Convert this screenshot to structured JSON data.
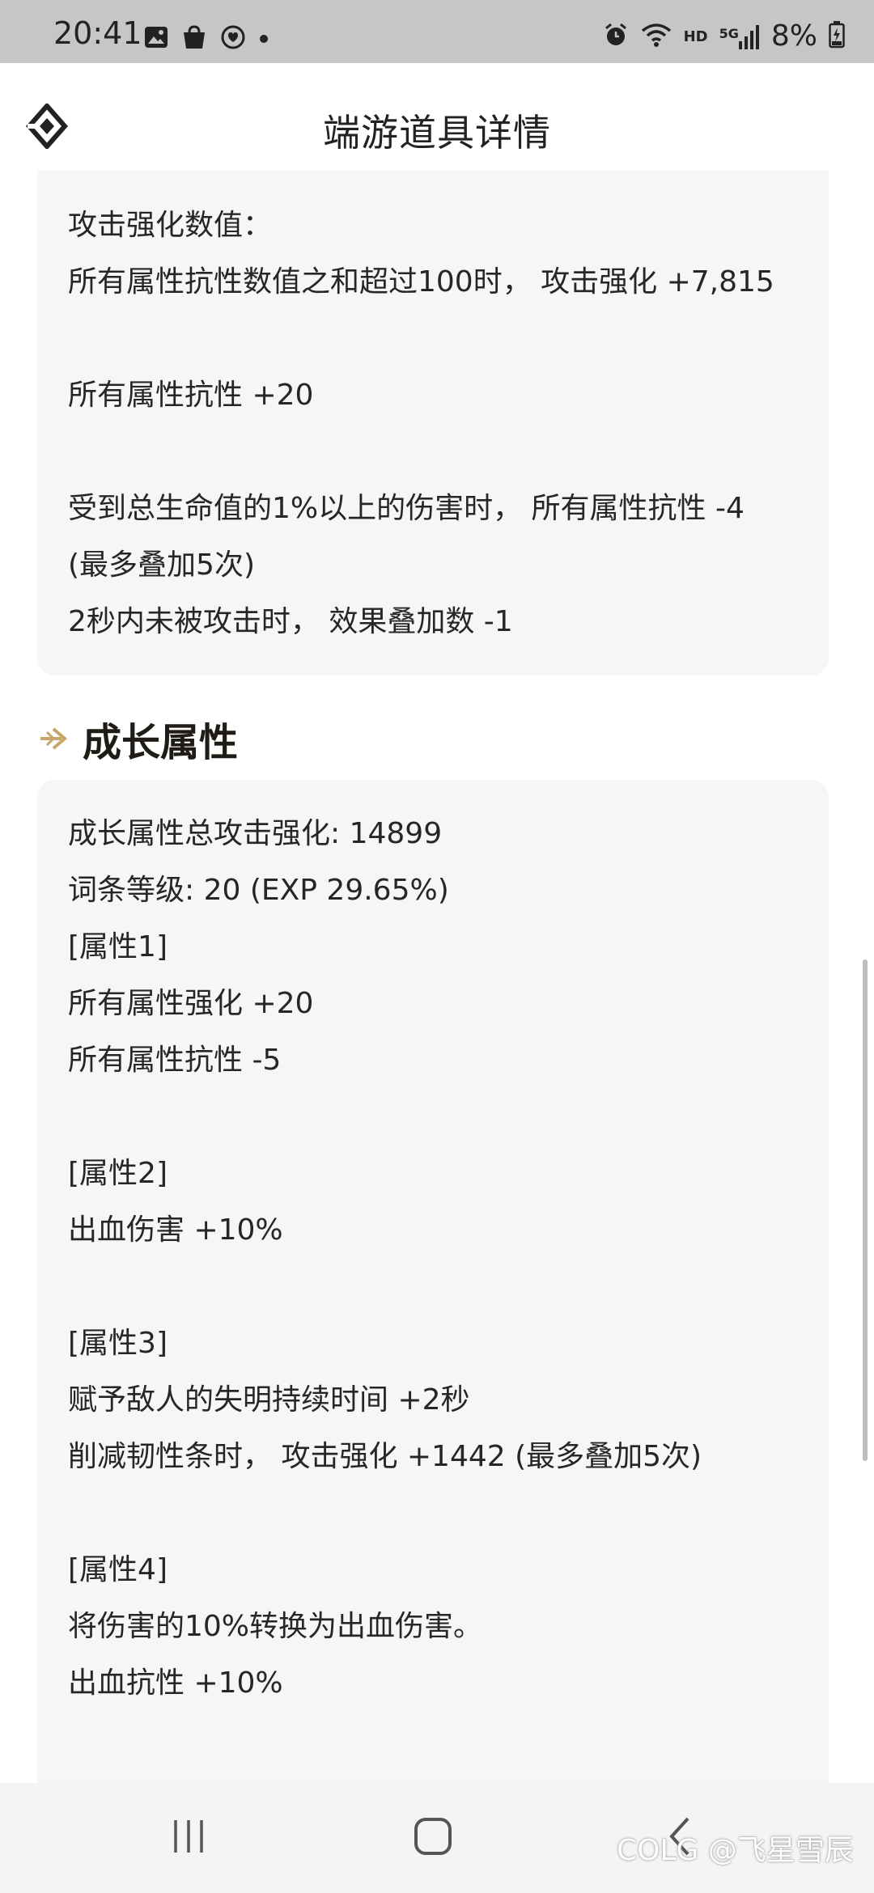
{
  "status_bar": {
    "time": "20:41",
    "left_icons": [
      "gallery-icon",
      "shopping-bag-icon",
      "heart-rate-icon",
      "dot-icon"
    ],
    "right_icons": [
      "alarm-icon",
      "wifi-icon",
      "hd-label",
      "signal-5g-icon",
      "battery-icon"
    ],
    "hd": "HD",
    "network": "5G",
    "battery": "8%"
  },
  "header": {
    "title": "端游道具详情",
    "logo_icon": "diamond-logo-icon"
  },
  "card1": {
    "lines": [
      "攻击强化数值：",
      "所有属性抗性数值之和超过100时， 攻击强化 +7,815",
      "所有属性抗性 +20",
      "受到总生命值的1%以上的伤害时， 所有属性抗性 -4",
      "(最多叠加5次)",
      "2秒内未被攻击时， 效果叠加数 -1"
    ]
  },
  "section": {
    "title": "成长属性",
    "icon": "arrow-right-icon"
  },
  "card2": {
    "lines": [
      "成长属性总攻击强化: 14899",
      "词条等级: 20 (EXP 29.65%)",
      "[属性1]",
      "所有属性强化 +20",
      "所有属性抗性 -5",
      "[属性2]",
      "出血伤害 +10%",
      "[属性3]",
      "赋予敌人的失明持续时间 +2秒",
      "削减韧性条时， 攻击强化 +1442 (最多叠加5次)",
      "[属性4]",
      "将伤害的10%转换为出血伤害。",
      "出血抗性 +10%"
    ]
  },
  "nav_bar": {
    "recent_icon": "recent-apps-icon",
    "home_icon": "home-icon",
    "back_icon": "back-icon"
  },
  "watermark": "COLG @飞星雪辰",
  "colors": {
    "accent_gold": "#c8a66a",
    "card_bg": "#f7f6f4",
    "status_bar_bg": "#c6c6c6"
  }
}
